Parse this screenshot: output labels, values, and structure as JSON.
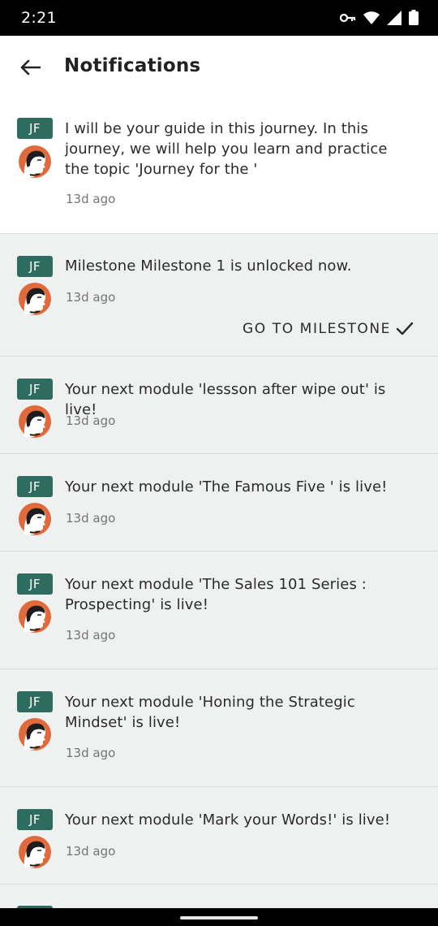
{
  "status_bar": {
    "time": "2:21"
  },
  "header": {
    "title": "Notifications"
  },
  "notifications": [
    {
      "badge": "JF",
      "message": "I will be your guide in this journey. In this journey, we will help you learn and practice the topic 'Journey for the '",
      "time": "13d ago",
      "state": "read"
    },
    {
      "badge": "JF",
      "message": "Milestone Milestone 1 is unlocked now.",
      "time": "13d ago",
      "state": "unread",
      "action": "GO TO MILESTONE"
    },
    {
      "badge": "JF",
      "message": "Your next module 'lessson after wipe out' is live!",
      "time": "13d ago",
      "state": "unread"
    },
    {
      "badge": "JF",
      "message": "Your next module 'The Famous Five ' is live!",
      "time": "13d ago",
      "state": "unread"
    },
    {
      "badge": "JF",
      "message": "Your next module 'The Sales 101 Series : Prospecting' is live!",
      "time": "13d ago",
      "state": "unread"
    },
    {
      "badge": "JF",
      "message": "Your next module 'Honing the Strategic Mindset' is live!",
      "time": "13d ago",
      "state": "unread"
    },
    {
      "badge": "JF",
      "message": "Your next module 'Mark your Words!' is live!",
      "time": "13d ago",
      "state": "unread"
    }
  ],
  "colors": {
    "badge": "#2e6c5f",
    "unread_bg": "#eef1f0",
    "avatar": "#e06a3c"
  }
}
